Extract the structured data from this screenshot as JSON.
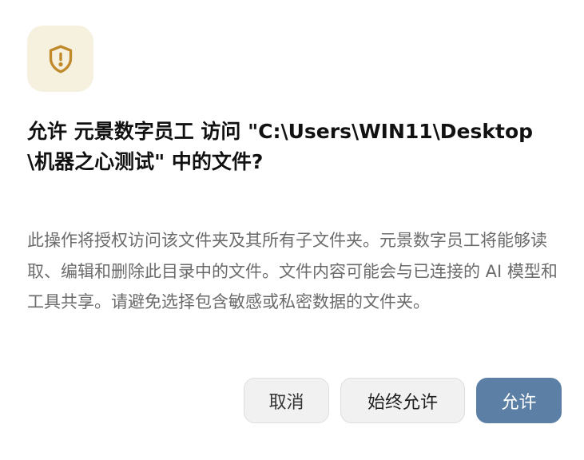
{
  "dialog": {
    "icon": "shield-alert-icon",
    "icon_color": "#c08a2b",
    "icon_background": "#f6f0de",
    "title": "允许 元景数字员工 访问 \"C:\\Users\\WIN11\\Desktop\\机器之心测试\" 中的文件?",
    "description": "此操作将授权访问该文件夹及其所有子文件夹。元景数字员工将能够读取、编辑和删除此目录中的文件。文件内容可能会与已连接的 AI 模型和工具共享。请避免选择包含敏感或私密数据的文件夹。",
    "buttons": {
      "cancel": "取消",
      "always_allow": "始终允许",
      "allow": "允许"
    },
    "accent_color": "#5c7fa5"
  }
}
